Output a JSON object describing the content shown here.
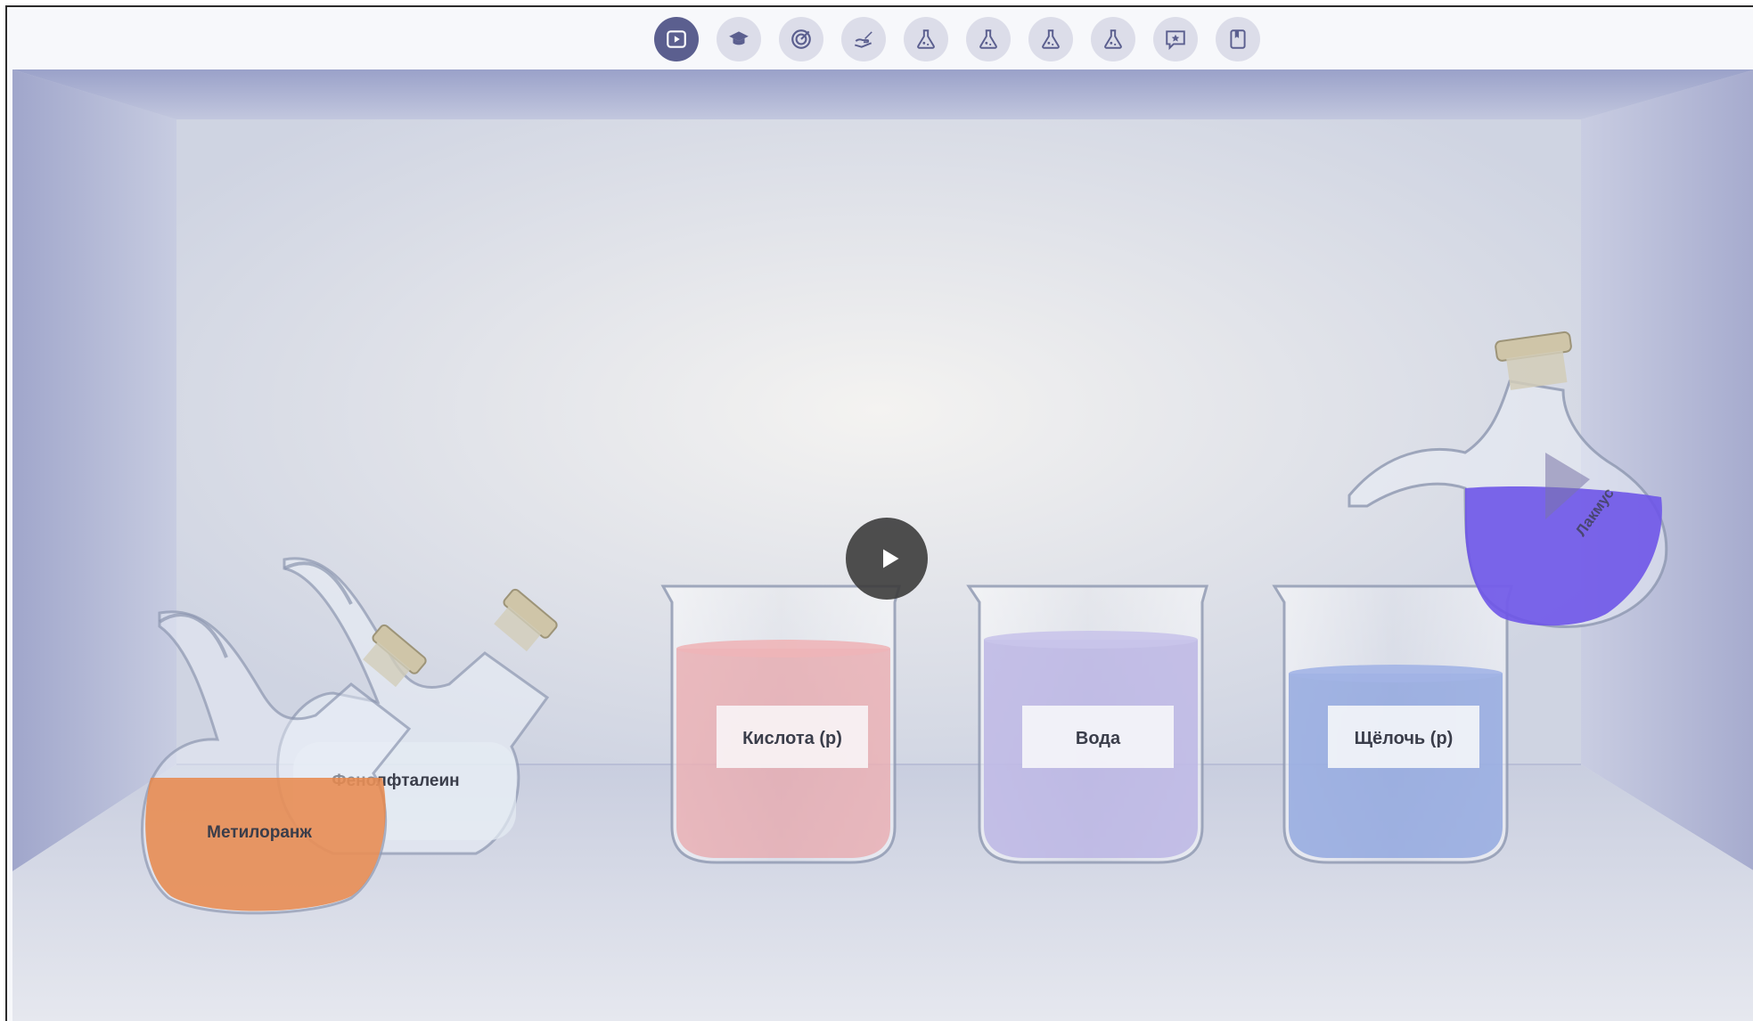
{
  "toolbar": {
    "buttons": [
      {
        "name": "video-button",
        "icon": "play-video-icon",
        "active": true
      },
      {
        "name": "theory-button",
        "icon": "graduation-cap-icon",
        "active": false
      },
      {
        "name": "goal-button",
        "icon": "target-icon",
        "active": false
      },
      {
        "name": "task-button",
        "icon": "pen-hand-icon",
        "active": false
      },
      {
        "name": "experiment-1-button",
        "icon": "flask-icon",
        "active": false
      },
      {
        "name": "experiment-2-button",
        "icon": "flask-icon",
        "active": false
      },
      {
        "name": "experiment-3-button",
        "icon": "flask-icon",
        "active": false
      },
      {
        "name": "experiment-4-button",
        "icon": "flask-icon",
        "active": false
      },
      {
        "name": "conclusion-button",
        "icon": "star-message-icon",
        "active": false
      },
      {
        "name": "bookmark-button",
        "icon": "bookmark-icon",
        "active": false
      }
    ],
    "active_color": "#5b5f8f",
    "inactive_color": "#dcdde9"
  },
  "flasks": {
    "methyl_orange": {
      "label": "Метилоранж",
      "liquid_color": "#e8874a"
    },
    "phenolphthalein": {
      "label": "Фенолфталеин",
      "liquid_color": "#e6ecf3"
    },
    "litmus": {
      "label": "Лакмус",
      "liquid_color": "#6e55e8"
    }
  },
  "beakers": [
    {
      "label": "Кислота (р)",
      "liquid_color": "#e8a2a6"
    },
    {
      "label": "Вода",
      "liquid_color": "#b9b3e3"
    },
    {
      "label": "Щёлочь (р)",
      "liquid_color": "#8fa5df"
    }
  ],
  "player": {
    "icon": "play-icon"
  }
}
